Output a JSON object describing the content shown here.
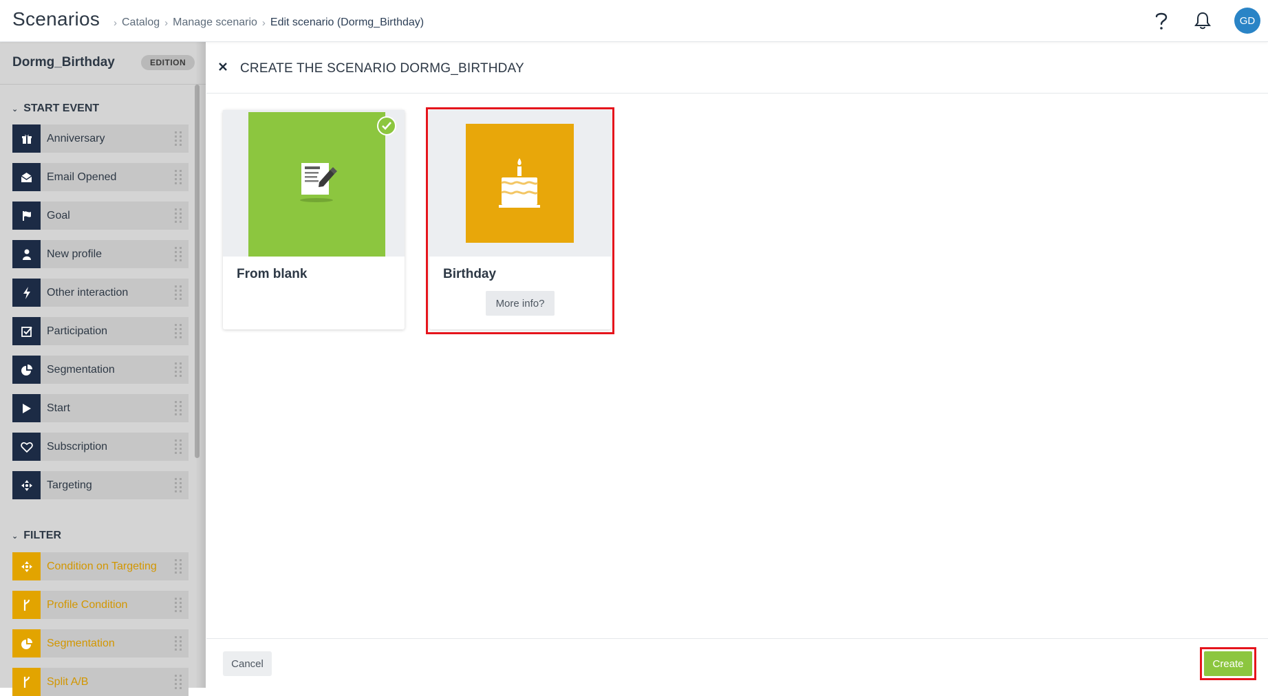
{
  "header": {
    "app_title": "Scenarios",
    "breadcrumb": [
      {
        "label": "Catalog"
      },
      {
        "label": "Manage scenario"
      },
      {
        "label": "Edit scenario (Dormg_Birthday)"
      }
    ],
    "help_icon": "question-mark-icon",
    "notification_icon": "bell-icon",
    "avatar_initials": "GD"
  },
  "sidebar": {
    "scenario_name": "Dormg_Birthday",
    "badge": "EDITION",
    "sections": {
      "start_event": {
        "title": "START EVENT",
        "items": [
          {
            "label": "Anniversary",
            "icon": "gift-icon"
          },
          {
            "label": "Email Opened",
            "icon": "envelope-open-icon"
          },
          {
            "label": "Goal",
            "icon": "flag-icon"
          },
          {
            "label": "New profile",
            "icon": "user-icon"
          },
          {
            "label": "Other interaction",
            "icon": "lightning-icon"
          },
          {
            "label": "Participation",
            "icon": "checkbox-icon"
          },
          {
            "label": "Segmentation",
            "icon": "pie-chart-icon"
          },
          {
            "label": "Start",
            "icon": "play-icon"
          },
          {
            "label": "Subscription",
            "icon": "heart-icon"
          },
          {
            "label": "Targeting",
            "icon": "crosshair-icon"
          }
        ]
      },
      "filter": {
        "title": "FILTER",
        "items": [
          {
            "label": "Condition on Targeting",
            "icon": "crosshair-icon"
          },
          {
            "label": "Profile Condition",
            "icon": "branch-icon"
          },
          {
            "label": "Segmentation",
            "icon": "pie-chart-icon"
          },
          {
            "label": "Split A/B",
            "icon": "branch-icon"
          }
        ]
      }
    }
  },
  "panel": {
    "title": "CREATE THE SCENARIO DORMG_BIRTHDAY",
    "templates": [
      {
        "label": "From blank",
        "selected": true,
        "icon": "document-edit-icon"
      },
      {
        "label": "Birthday",
        "selected": false,
        "icon": "birthday-cake-icon",
        "more_info": "More info?"
      }
    ]
  },
  "footer": {
    "cancel_label": "Cancel",
    "create_label": "Create"
  },
  "colors": {
    "accent_green": "#8cc63f",
    "birthday_orange": "#e8a70a",
    "start_icon_bg": "#1c2b45",
    "filter_icon_bg": "#e2a400",
    "highlight_red": "#e5141c",
    "avatar_blue": "#2a84c6"
  }
}
